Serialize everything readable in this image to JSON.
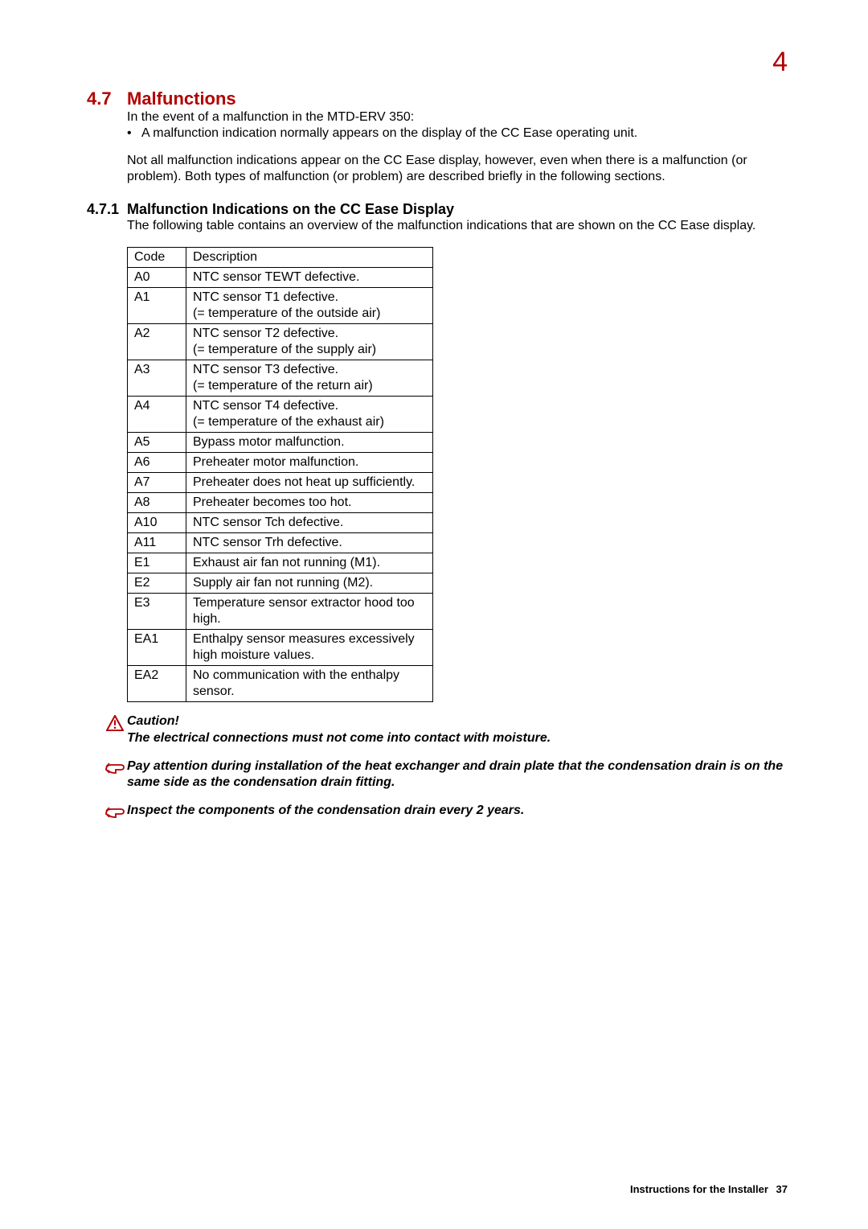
{
  "chapter_number": "4",
  "section": {
    "number": "4.7",
    "title": "Malfunctions",
    "intro_line": "In the event of a malfunction in the MTD-ERV 350:",
    "bullets": [
      "A malfunction indication normally appears on the display of the CC Ease operating unit."
    ],
    "para2": "Not all malfunction indications appear on the CC Ease display, however, even when there is a malfunction (or problem). Both types of malfunction (or problem) are described briefly in the following sections."
  },
  "subsection": {
    "number": "4.7.1",
    "title": "Malfunction Indications on the CC Ease Display",
    "intro": "The following table contains an overview of the malfunction indications that are shown on the CC Ease display."
  },
  "table": {
    "head_code": "Code",
    "head_desc": "Description",
    "rows": [
      {
        "code": "A0",
        "desc": "NTC sensor TEWT defective."
      },
      {
        "code": "A1",
        "desc": "NTC sensor T1 defective.\n(= temperature of the outside air)"
      },
      {
        "code": "A2",
        "desc": "NTC sensor T2 defective.\n(= temperature of the supply air)"
      },
      {
        "code": "A3",
        "desc": "NTC sensor T3 defective.\n(= temperature of the return air)"
      },
      {
        "code": "A4",
        "desc": "NTC sensor T4 defective.\n(= temperature of the exhaust air)"
      },
      {
        "code": "A5",
        "desc": "Bypass motor malfunction."
      },
      {
        "code": "A6",
        "desc": "Preheater motor malfunction."
      },
      {
        "code": "A7",
        "desc": "Preheater does not heat up sufﬁciently."
      },
      {
        "code": "A8",
        "desc": "Preheater becomes too hot."
      },
      {
        "code": "A10",
        "desc": "NTC sensor Tch defective."
      },
      {
        "code": "A11",
        "desc": "NTC sensor Trh defective."
      },
      {
        "code": "E1",
        "desc": "Exhaust air fan not running (M1)."
      },
      {
        "code": "E2",
        "desc": "Supply air fan not running (M2)."
      },
      {
        "code": "E3",
        "desc": "Temperature sensor extractor hood too high."
      },
      {
        "code": "EA1",
        "desc": "Enthalpy sensor measures excessively high moisture values."
      },
      {
        "code": "EA2",
        "desc": "No communication with the enthalpy sensor."
      }
    ]
  },
  "notes": {
    "caution_label": "Caution!",
    "caution_text": "The electrical connections must not come into contact with moisture.",
    "note1": "Pay attention during installation of the heat exchanger and drain plate that the condensation drain is on the same side as the condensation drain fitting.",
    "note2": "Inspect the components of the condensation drain every 2 years."
  },
  "footer": {
    "label": "Instructions for the Installer",
    "page": "37"
  }
}
